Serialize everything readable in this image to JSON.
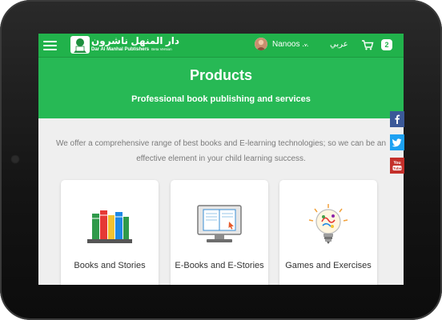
{
  "header": {
    "brand_ar": "دار المنهل ناشرون",
    "brand_en": "Dar Al Manhal Publishers",
    "beta_label": "Beta Version",
    "user_name": "Nanoos ...",
    "language_toggle": "عربي",
    "cart_count": "2"
  },
  "hero": {
    "title": "Products",
    "subtitle": "Professional book publishing and services"
  },
  "intro_text": "We offer a comprehensive range of best books and E-learning technologies; so we can be an effective element in your child learning success.",
  "products": [
    {
      "label": "Books and Stories",
      "icon": "books-icon"
    },
    {
      "label": "E-Books and E-Stories",
      "icon": "ebook-monitor-icon"
    },
    {
      "label": "Games and Exercises",
      "icon": "lightbulb-brain-icon"
    }
  ],
  "social": [
    "facebook",
    "twitter",
    "youtube"
  ],
  "colors": {
    "header_green": "#21b24b",
    "hero_green": "#27b955",
    "facebook": "#3b5998",
    "twitter": "#1da1f2",
    "youtube": "#c4302b"
  }
}
